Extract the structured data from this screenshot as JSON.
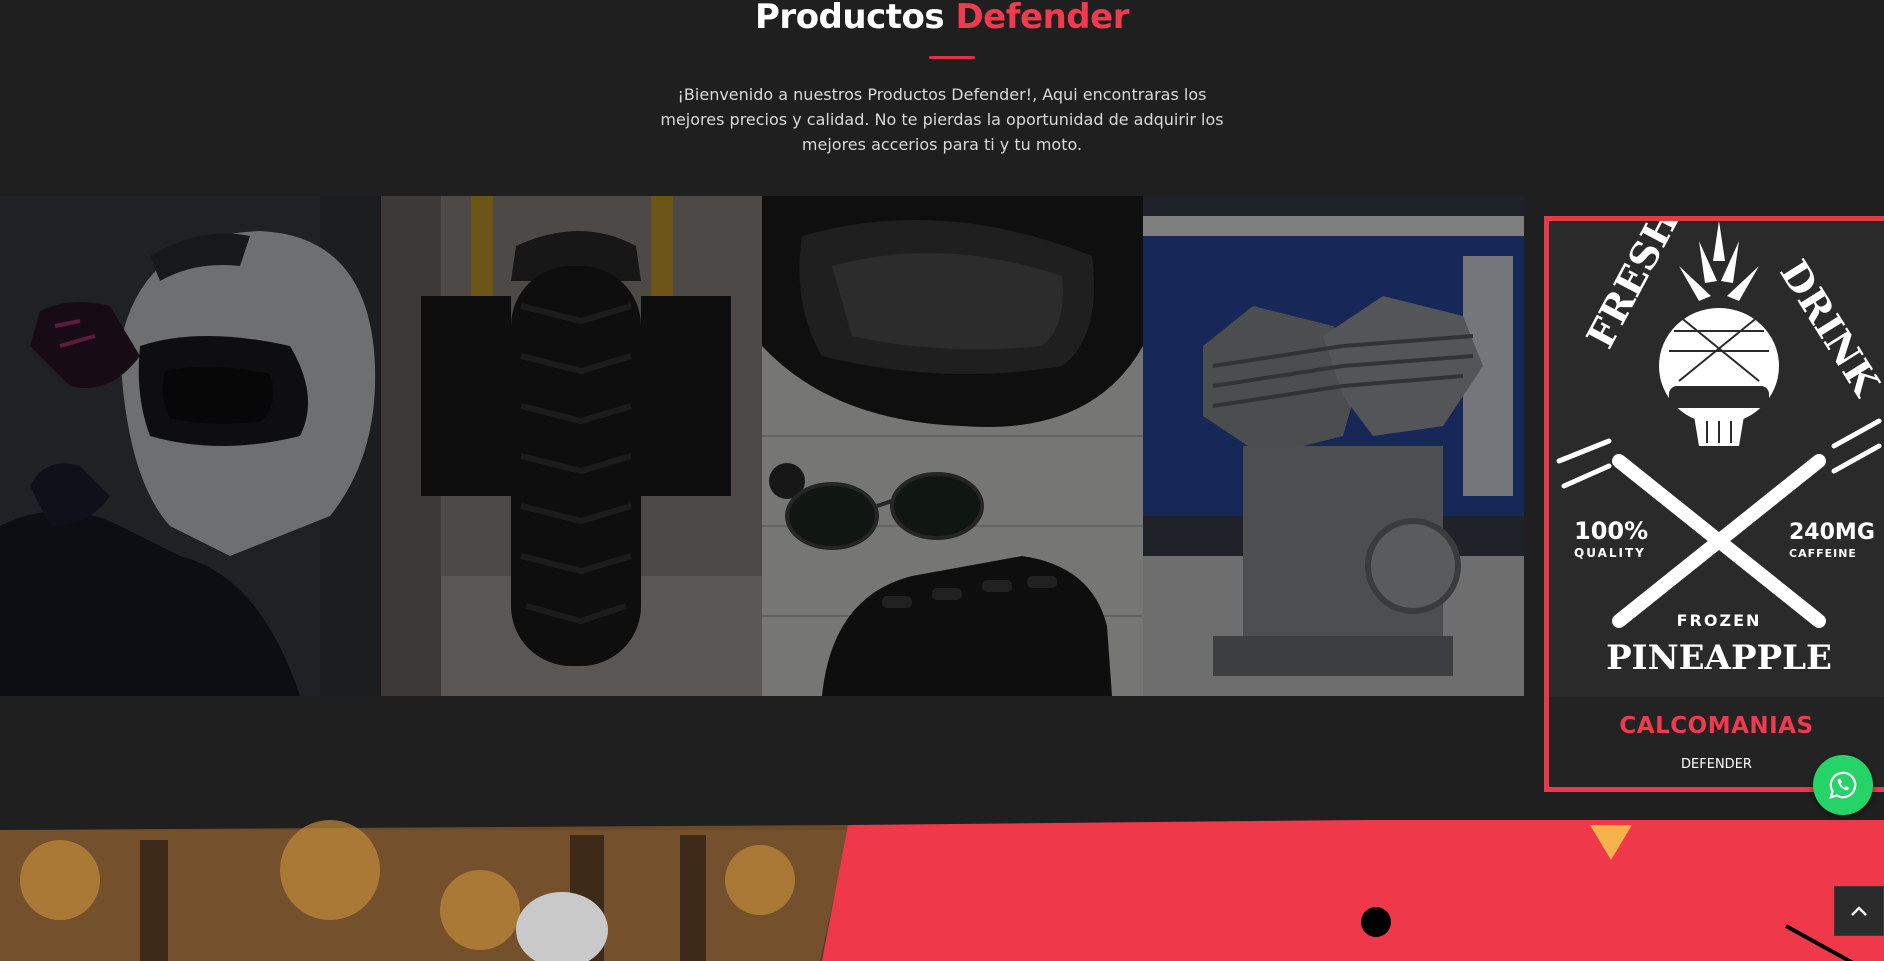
{
  "section": {
    "title_part1": "Productos",
    "title_part2": "Defender",
    "intro": "¡Bienvenido a nuestros Productos Defender!, Aqui encontraras los mejores precios y calidad. No te pierdas la oportunidad de adquirir los mejores accerios para ti y tu moto."
  },
  "gallery": {
    "tiles": [
      {
        "subject": "helmet-rider"
      },
      {
        "subject": "motorcycle-tire"
      },
      {
        "subject": "helmet-gloves-sunglasses"
      },
      {
        "subject": "motorcycle-engine"
      }
    ]
  },
  "card": {
    "art": {
      "top_left": "FRESH",
      "top_right": "DRINK",
      "left_big": "100%",
      "left_small": "QUALITY",
      "right_big": "240MG",
      "right_small": "CAFFEINE",
      "bottom_small": "FROZEN",
      "bottom_big": "PINEAPPLE"
    },
    "title": "CALCOMANIAS",
    "subtitle": "DEFENDER"
  },
  "colors": {
    "accent": "#f03a4d",
    "background": "#1f1f1f",
    "whatsapp": "#25d366",
    "triangle": "#f6b24a"
  },
  "icons": {
    "whatsapp": "whatsapp-icon",
    "scroll_top": "chevron-up-icon"
  }
}
